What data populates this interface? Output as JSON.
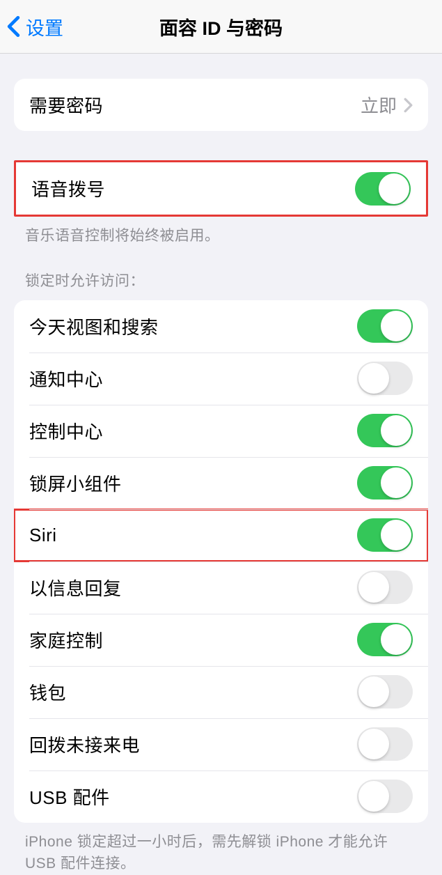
{
  "header": {
    "back_label": "设置",
    "title": "面容 ID 与密码"
  },
  "passcode": {
    "label": "需要密码",
    "value": "立即"
  },
  "voice_dial": {
    "label": "语音拨号",
    "on": true,
    "footer": "音乐语音控制将始终被启用。"
  },
  "locked_access": {
    "section_header": "锁定时允许访问：",
    "items": [
      {
        "label": "今天视图和搜索",
        "on": true
      },
      {
        "label": "通知中心",
        "on": false
      },
      {
        "label": "控制中心",
        "on": true
      },
      {
        "label": "锁屏小组件",
        "on": true
      },
      {
        "label": "Siri",
        "on": true
      },
      {
        "label": "以信息回复",
        "on": false
      },
      {
        "label": "家庭控制",
        "on": true
      },
      {
        "label": "钱包",
        "on": false
      },
      {
        "label": "回拨未接来电",
        "on": false
      },
      {
        "label": "USB 配件",
        "on": false
      }
    ],
    "footer": "iPhone 锁定超过一小时后，需先解锁 iPhone 才能允许 USB 配件连接。"
  }
}
